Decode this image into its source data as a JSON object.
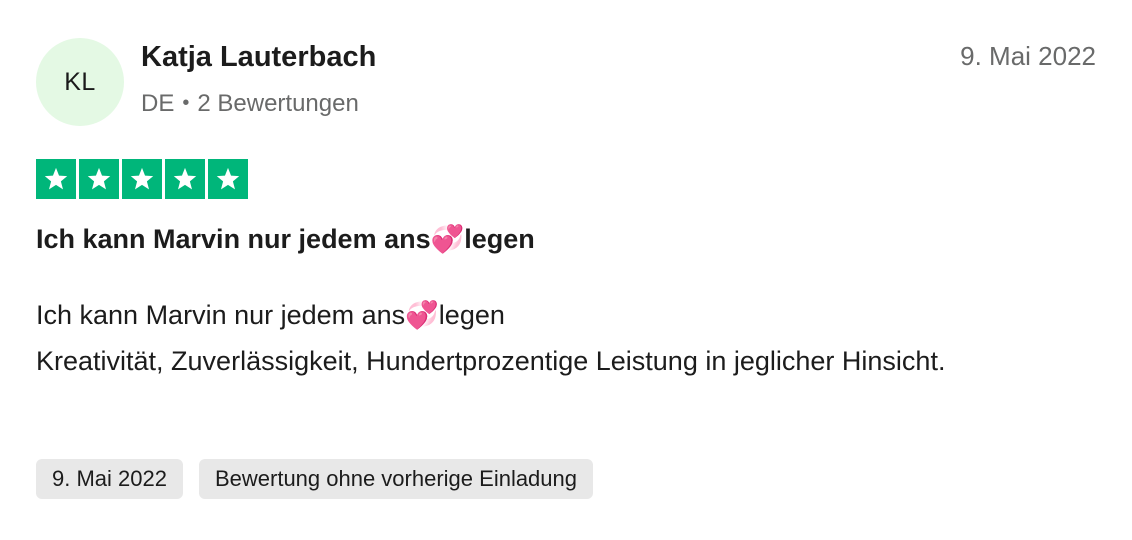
{
  "author": {
    "initials": "KL",
    "name": "Katja Lauterbach",
    "country": "DE",
    "separator": "•",
    "review_count": "2 Bewertungen"
  },
  "review": {
    "date": "9. Mai 2022",
    "rating": 5,
    "rating_max": 5,
    "rating_color": "#00b67a",
    "title": "Ich kann Marvin nur jedem ans💞legen",
    "body_lines": [
      "Ich kann Marvin nur jedem ans💞legen",
      "Kreativität, Zuverlässigkeit, Hundertprozentige Leistung in jeglicher Hinsicht."
    ]
  },
  "tags": [
    "9. Mai 2022",
    "Bewertung ohne vorherige Einladung"
  ],
  "colors": {
    "avatar_bg": "#e4f9e4",
    "tag_bg": "#e8e8e8",
    "meta_text": "#696a6a"
  }
}
